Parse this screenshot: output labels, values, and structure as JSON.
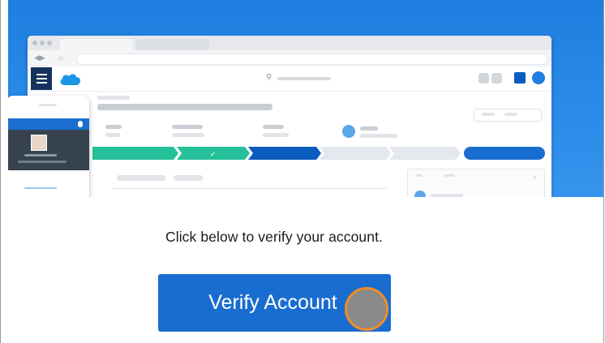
{
  "hero": {
    "accent_color": "#1e7fe0",
    "brand_logo": "cloud-logo-icon"
  },
  "content": {
    "prompt": "Click below to verify your account.",
    "verify_button_label": "Verify Account",
    "button_color": "#1a6dd0"
  },
  "cursor": {
    "indicator": "click-cursor-icon",
    "ring_color": "#f28c28"
  }
}
